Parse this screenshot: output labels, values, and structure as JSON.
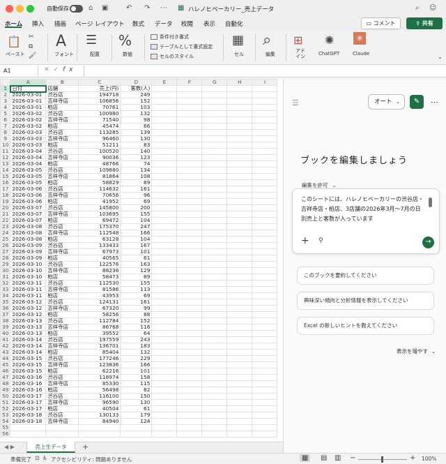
{
  "window": {
    "autosave": "自動保存",
    "title": "ハレノヒベーカリー_売上データ"
  },
  "ribbon_tabs": [
    "ホーム",
    "挿入",
    "描画",
    "ページ レイアウト",
    "数式",
    "データ",
    "校閲",
    "表示",
    "自動化"
  ],
  "header_buttons": {
    "comment": "コメント",
    "share": "共有"
  },
  "ribbon": {
    "paste": "ペースト",
    "font": "フォント",
    "align": "配置",
    "number": "数値",
    "conditional_format": "条件付き書式",
    "table_format": "テーブルとして書式設定",
    "cell_styles": "セルのスタイル",
    "cells": "セル",
    "edit": "編集",
    "addins": "アド\nイン",
    "chatgpt": "ChatGPT",
    "claude": "Claude"
  },
  "formula_bar": {
    "cell_ref": "A1",
    "value": ""
  },
  "columns": [
    "A",
    "B",
    "C",
    "D",
    "E",
    "F",
    "G",
    "H",
    "I"
  ],
  "headers": [
    "日付",
    "店舗",
    "売上(円)",
    "客数(人)"
  ],
  "rows": [
    [
      "2026-03-01",
      "渋谷店",
      "194718",
      "249"
    ],
    [
      "2026-03-01",
      "吉祥寺店",
      "106856",
      "152"
    ],
    [
      "2026-03-01",
      "柏店",
      "70761",
      "103"
    ],
    [
      "2026-03-02",
      "渋谷店",
      "100980",
      "132"
    ],
    [
      "2026-03-02",
      "吉祥寺店",
      "71540",
      "98"
    ],
    [
      "2026-03-02",
      "柏店",
      "45474",
      "66"
    ],
    [
      "2026-03-03",
      "渋谷店",
      "113285",
      "139"
    ],
    [
      "2026-03-03",
      "吉祥寺店",
      "96460",
      "130"
    ],
    [
      "2026-03-03",
      "柏店",
      "51211",
      "83"
    ],
    [
      "2026-03-04",
      "渋谷店",
      "100520",
      "140"
    ],
    [
      "2026-03-04",
      "吉祥寺店",
      "90036",
      "123"
    ],
    [
      "2026-03-04",
      "柏店",
      "48766",
      "74"
    ],
    [
      "2026-03-05",
      "渋谷店",
      "109880",
      "134"
    ],
    [
      "2026-03-05",
      "吉祥寺店",
      "81864",
      "108"
    ],
    [
      "2026-03-05",
      "柏店",
      "58829",
      "89"
    ],
    [
      "2026-03-06",
      "渋谷店",
      "114632",
      "161"
    ],
    [
      "2026-03-06",
      "吉祥寺店",
      "70656",
      "96"
    ],
    [
      "2026-03-06",
      "柏店",
      "41952",
      "69"
    ],
    [
      "2026-03-07",
      "渋谷店",
      "145800",
      "200"
    ],
    [
      "2026-03-07",
      "吉祥寺店",
      "103695",
      "155"
    ],
    [
      "2026-03-07",
      "柏店",
      "69472",
      "104"
    ],
    [
      "2026-03-08",
      "渋谷店",
      "175370",
      "247"
    ],
    [
      "2026-03-08",
      "吉祥寺店",
      "112548",
      "166"
    ],
    [
      "2026-03-08",
      "柏店",
      "63128",
      "104"
    ],
    [
      "2026-03-09",
      "渋谷店",
      "133433",
      "167"
    ],
    [
      "2026-03-09",
      "吉祥寺店",
      "67973",
      "101"
    ],
    [
      "2026-03-09",
      "柏店",
      "40565",
      "61"
    ],
    [
      "2026-03-10",
      "渋谷店",
      "122576",
      "163"
    ],
    [
      "2026-03-10",
      "吉祥寺店",
      "88236",
      "129"
    ],
    [
      "2026-03-10",
      "柏店",
      "58473",
      "89"
    ],
    [
      "2026-03-11",
      "渋谷店",
      "112530",
      "155"
    ],
    [
      "2026-03-11",
      "吉祥寺店",
      "81586",
      "113"
    ],
    [
      "2026-03-11",
      "柏店",
      "43953",
      "69"
    ],
    [
      "2026-03-12",
      "渋谷店",
      "124131",
      "161"
    ],
    [
      "2026-03-12",
      "吉祥寺店",
      "67320",
      "99"
    ],
    [
      "2026-03-12",
      "柏店",
      "58256",
      "88"
    ],
    [
      "2026-03-13",
      "渋谷店",
      "112784",
      "152"
    ],
    [
      "2026-03-13",
      "吉祥寺店",
      "86768",
      "116"
    ],
    [
      "2026-03-13",
      "柏店",
      "39552",
      "64"
    ],
    [
      "2026-03-14",
      "渋谷店",
      "197559",
      "243"
    ],
    [
      "2026-03-14",
      "吉祥寺店",
      "136701",
      "183"
    ],
    [
      "2026-03-14",
      "柏店",
      "85404",
      "132"
    ],
    [
      "2026-03-15",
      "渋谷店",
      "177246",
      "229"
    ],
    [
      "2026-03-15",
      "吉祥寺店",
      "123836",
      "166"
    ],
    [
      "2026-03-15",
      "柏店",
      "62216",
      "101"
    ],
    [
      "2026-03-16",
      "渋谷店",
      "118974",
      "158"
    ],
    [
      "2026-03-16",
      "吉祥寺店",
      "85330",
      "115"
    ],
    [
      "2026-03-16",
      "柏店",
      "56498",
      "82"
    ],
    [
      "2026-03-17",
      "渋谷店",
      "116100",
      "150"
    ],
    [
      "2026-03-17",
      "吉祥寺店",
      "96590",
      "130"
    ],
    [
      "2026-03-17",
      "柏店",
      "40504",
      "61"
    ],
    [
      "2026-03-18",
      "渋谷店",
      "130133",
      "179"
    ],
    [
      "2026-03-18",
      "吉祥寺店",
      "84940",
      "124"
    ]
  ],
  "sheet_tab": "売上生データ",
  "status": {
    "ready": "準備完了",
    "accessibility": "アクセシビリティ: 問題ありません",
    "zoom": "100%"
  },
  "pane": {
    "mode": "オート",
    "heading": "ブックを編集しましょう",
    "permit": "編集を許可",
    "prompt": "このシートには、ハレノヒベーカリーの渋谷店・吉祥寺店・柏店、3店舗の2026年3月〜7月の日別売上と客数が入っています",
    "suggestions": [
      "このブックを要約してください",
      "興味深い傾向と分析情報を表示してください",
      "Excel の新しいヒントを教えてください"
    ],
    "more": "表示を増やす"
  },
  "colors": {
    "accent": "#1e7145"
  }
}
